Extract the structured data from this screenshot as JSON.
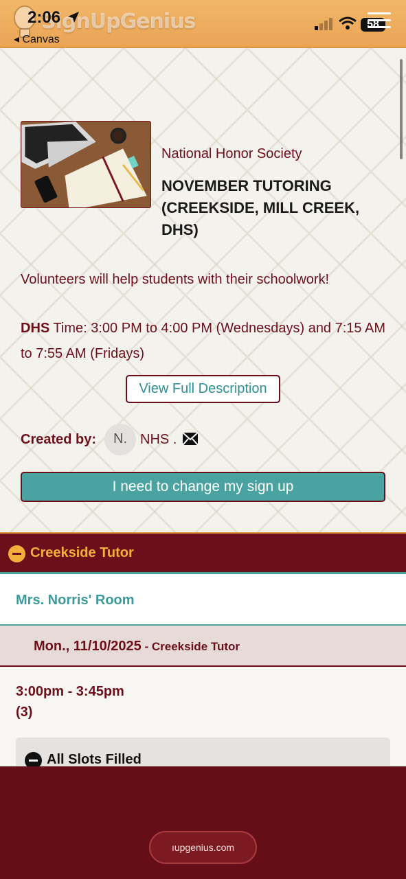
{
  "status_bar": {
    "time": "2:06",
    "back_label": "◂ Canvas",
    "battery": "58"
  },
  "header": {
    "logo_text": "SignUpGenius"
  },
  "event": {
    "organization": "National Honor Society",
    "title": "NOVEMBER TUTORING (CREEKSIDE, MILL CREEK, DHS)",
    "description": "Volunteers will help students with their schoolwork!",
    "time_prefix": "DHS",
    "time_text": " Time: 3:00 PM to 4:00 PM (Wednesdays) and 7:15 AM to 7:55 AM (Fridays)",
    "view_full_label": "View Full Description",
    "created_by_label": "Created by:",
    "creator_initial": "N.",
    "creator_name": "NHS .",
    "change_signup_label": "I need to change my sign up"
  },
  "section": {
    "title": "Creekside Tutor",
    "location": "Mrs. Norris' Room",
    "date": "Mon., 11/10/2025",
    "date_suffix": " - Creekside Tutor",
    "slot_time": "3:00pm - 3:45pm",
    "slot_count": "(3)",
    "slot_status": "All Slots Filled"
  },
  "footer": {
    "url": "ıupgenius.com"
  },
  "colors": {
    "brand_maroon": "#6b0f1a",
    "brand_orange": "#f2b768",
    "accent_teal": "#4aa3a0"
  }
}
